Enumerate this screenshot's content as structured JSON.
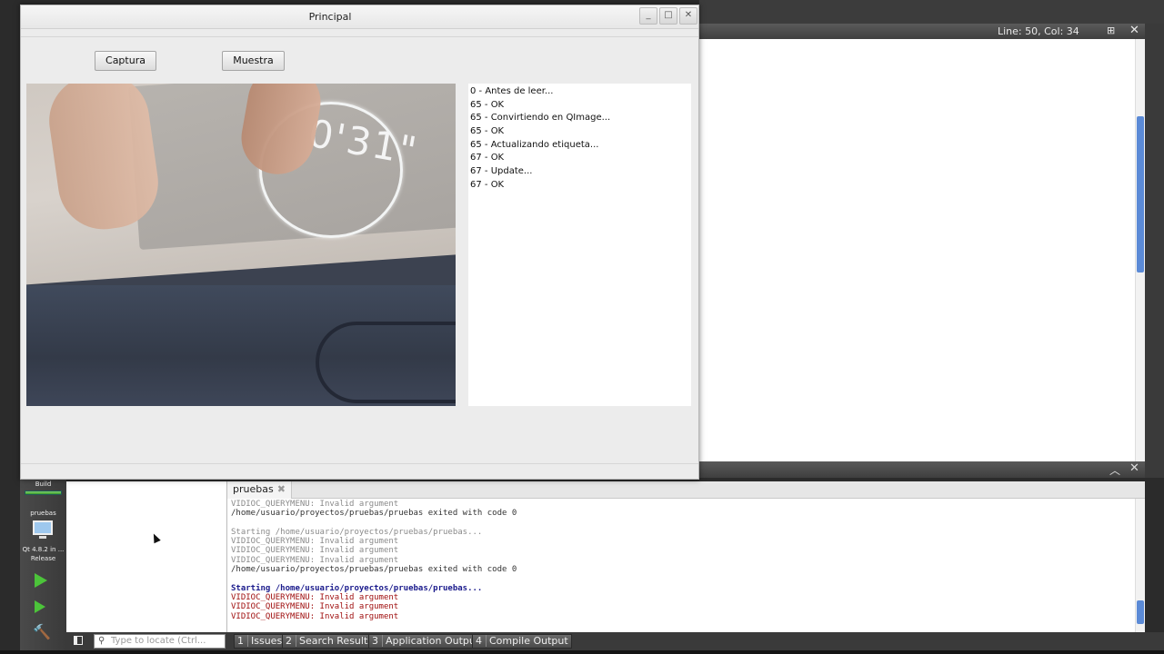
{
  "ide": {
    "editor_status": "Line: 50, Col: 34",
    "split_icon": "⊞",
    "close_icon": "✕",
    "collapse_icon": "︿"
  },
  "modebar": {
    "build_label": "Build",
    "project_label": "pruebas",
    "kit_label": "Qt 4.8.2 in ...",
    "config_label": "Release"
  },
  "output": {
    "tab_label": "pruebas",
    "tab_close": "✖",
    "lines": [
      {
        "text": "VIDIOC_QUERYMENU: Invalid argument",
        "style": "grey"
      },
      {
        "text": "/home/usuario/proyectos/pruebas/pruebas exited with code 0",
        "style": "path"
      },
      {
        "text": "",
        "style": "grey"
      },
      {
        "text": "Starting /home/usuario/proyectos/pruebas/pruebas...",
        "style": "grey"
      },
      {
        "text": "VIDIOC_QUERYMENU: Invalid argument",
        "style": "grey"
      },
      {
        "text": "VIDIOC_QUERYMENU: Invalid argument",
        "style": "grey"
      },
      {
        "text": "VIDIOC_QUERYMENU: Invalid argument",
        "style": "grey"
      },
      {
        "text": "/home/usuario/proyectos/pruebas/pruebas exited with code 0",
        "style": "path"
      },
      {
        "text": "",
        "style": "grey"
      },
      {
        "text": "Starting /home/usuario/proyectos/pruebas/pruebas...",
        "style": "blue"
      },
      {
        "text": "VIDIOC_QUERYMENU: Invalid argument",
        "style": "red"
      },
      {
        "text": "VIDIOC_QUERYMENU: Invalid argument",
        "style": "red"
      },
      {
        "text": "VIDIOC_QUERYMENU: Invalid argument",
        "style": "red"
      }
    ]
  },
  "statusbar": {
    "locator_placeholder": "Type to locate (Ctrl...",
    "buttons": [
      {
        "num": "1",
        "label": "Issues"
      },
      {
        "num": "2",
        "label": "Search Results"
      },
      {
        "num": "3",
        "label": "Application Output"
      },
      {
        "num": "4",
        "label": "Compile Output"
      }
    ]
  },
  "window": {
    "title": "Principal",
    "minimize": "_",
    "maximize": "□",
    "close": "✕",
    "capture_label": "Captura",
    "show_label": "Muestra",
    "log_items": [
      "0 - Antes de leer...",
      "65 - OK",
      "65 - Convirtiendo en QImage...",
      "65 - OK",
      "65 - Actualizando etiqueta...",
      "67 - OK",
      "67 - Update...",
      "67 - OK"
    ]
  }
}
